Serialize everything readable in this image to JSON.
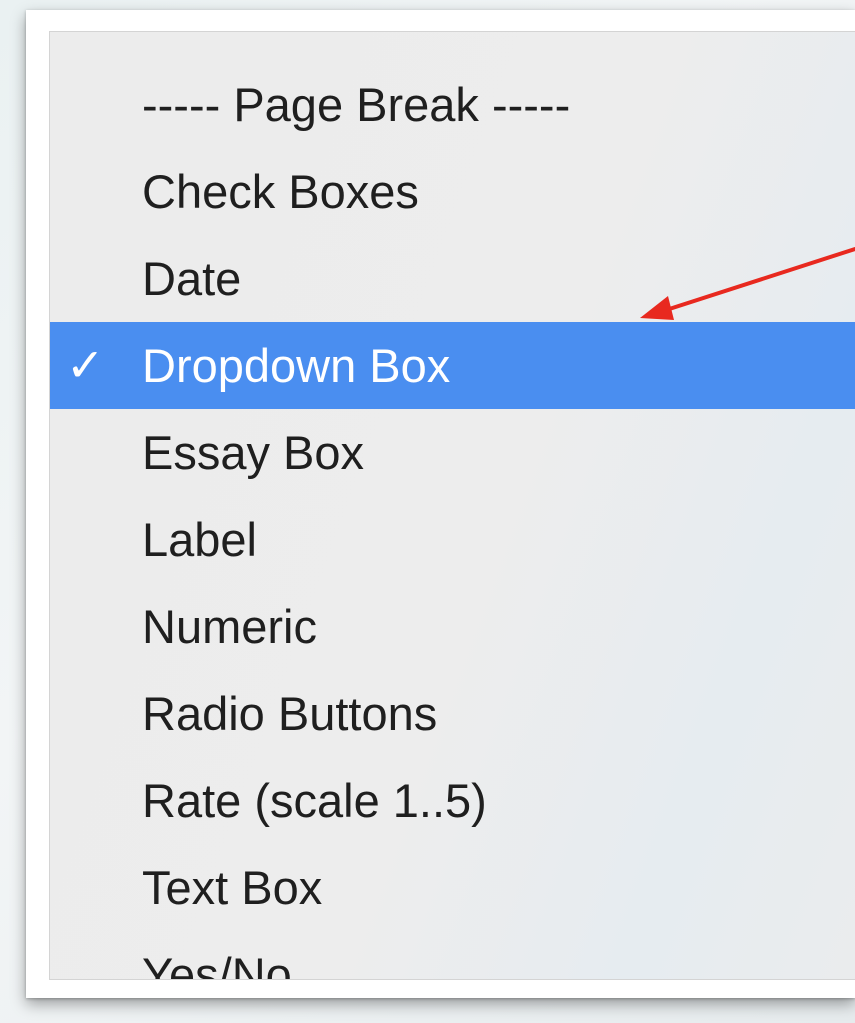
{
  "menu": {
    "items": [
      {
        "label": "----- Page Break -----",
        "selected": false
      },
      {
        "label": "Check Boxes",
        "selected": false
      },
      {
        "label": "Date",
        "selected": false
      },
      {
        "label": "Dropdown Box",
        "selected": true
      },
      {
        "label": "Essay Box",
        "selected": false
      },
      {
        "label": "Label",
        "selected": false
      },
      {
        "label": "Numeric",
        "selected": false
      },
      {
        "label": "Radio Buttons",
        "selected": false
      },
      {
        "label": "Rate (scale 1..5)",
        "selected": false
      },
      {
        "label": "Text Box",
        "selected": false
      },
      {
        "label": "Yes/No",
        "selected": false
      }
    ],
    "check_glyph": "✓",
    "selected_color": "#4a8ef0"
  },
  "annotation": {
    "type": "arrow-icon",
    "color": "#e8291f"
  }
}
